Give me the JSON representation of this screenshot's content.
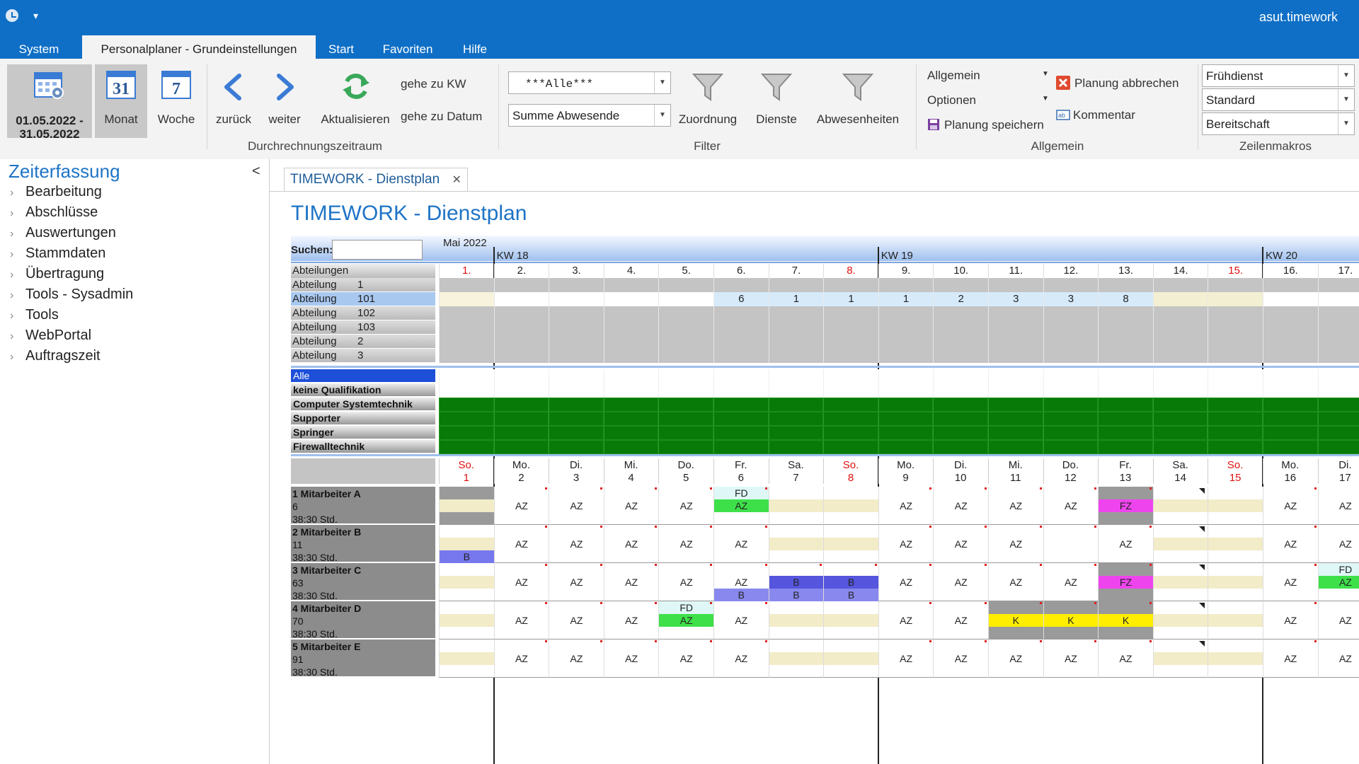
{
  "app": {
    "title": "asut.timework",
    "quick_access": "▾"
  },
  "menu_tabs": [
    "System",
    "Personalplaner - Grundeinstellungen",
    "Start",
    "Favoriten",
    "Hilfe"
  ],
  "ribbon": {
    "date_range_from": "01.05.2022 -",
    "date_range_to": "31.05.2022",
    "monat_label": "Monat",
    "monat_num": "31",
    "woche_label": "Woche",
    "woche_num": "7",
    "zurueck": "zurück",
    "weiter": "weiter",
    "aktualisieren": "Aktualisieren",
    "gehe_kw": "gehe zu KW",
    "gehe_datum": "gehe zu Datum",
    "group_zeitraum": "Durchrechnungszeitraum",
    "filter_combo1": "***Alle***",
    "filter_combo2": "Summe Abwesende",
    "zuordnung": "Zuordnung",
    "dienste": "Dienste",
    "abwesenheiten": "Abwesenheiten",
    "group_filter": "Filter",
    "allgemein": "Allgemein",
    "optionen": "Optionen",
    "planung_speichern": "Planung speichern",
    "planung_abbrechen": "Planung abbrechen",
    "kommentar": "Kommentar",
    "group_allgemein": "Allgemein",
    "makro1": "Frühdienst",
    "makro2": "Standard",
    "makro3": "Bereitschaft",
    "group_makros": "Zeilenmakros"
  },
  "nav": {
    "title": "Zeiterfassung",
    "collapse": "<",
    "items": [
      "Bearbeitung",
      "Abschlüsse",
      "Auswertungen",
      "Stammdaten",
      "Übertragung",
      "Tools - Sysadmin",
      "Tools",
      "WebPortal",
      "Auftragszeit"
    ]
  },
  "doc": {
    "tab": "TIMEWORK - Dienstplan",
    "tab_close": "✕",
    "title": "TIMEWORK - Dienstplan"
  },
  "plan": {
    "search_label": "Suchen:",
    "month_label": "Mai 2022",
    "kw": [
      "KW 18",
      "KW 19",
      "KW 20"
    ],
    "dept_header": "Abteilungen",
    "days": [
      "1.",
      "2.",
      "3.",
      "4.",
      "5.",
      "6.",
      "7.",
      "8.",
      "9.",
      "10.",
      "11.",
      "12.",
      "13.",
      "14.",
      "15.",
      "16.",
      "17."
    ],
    "weekday_short": [
      "So.",
      "Mo.",
      "Di.",
      "Mi.",
      "Do.",
      "Fr.",
      "Sa.",
      "So.",
      "Mo.",
      "Di.",
      "Mi.",
      "Do.",
      "Fr.",
      "Sa.",
      "So.",
      "Mo.",
      "Di."
    ],
    "day_nums": [
      "1",
      "2",
      "3",
      "4",
      "5",
      "6",
      "7",
      "8",
      "9",
      "10",
      "11",
      "12",
      "13",
      "14",
      "15",
      "16",
      "17"
    ],
    "red_days": [
      0,
      7,
      14
    ],
    "departments": [
      {
        "name": "Abteilung",
        "num": "1",
        "values": []
      },
      {
        "name": "Abteilung",
        "num": "101",
        "values": [
          "",
          "",
          "",
          "",
          "",
          "6",
          "1",
          "1",
          "1",
          "2",
          "3",
          "3",
          "8",
          "",
          "",
          "",
          ""
        ]
      },
      {
        "name": "Abteilung",
        "num": "102",
        "values": []
      },
      {
        "name": "Abteilung",
        "num": "103",
        "values": []
      },
      {
        "name": "Abteilung",
        "num": "2",
        "values": []
      },
      {
        "name": "Abteilung",
        "num": "3",
        "values": []
      }
    ],
    "qualifications": [
      "Alle",
      "keine Qualifikation",
      "Computer Systemtechnik",
      "Supporter",
      "Springer",
      "Firewalltechnik"
    ],
    "employees": [
      {
        "label": "1 Mitarbeiter A",
        "num": "6",
        "hours": "38:30 Std.",
        "cells": [
          {
            "type": "absent_top"
          },
          {
            "mid": "AZ"
          },
          {
            "mid": "AZ"
          },
          {
            "mid": "AZ"
          },
          {
            "mid": "AZ"
          },
          {
            "top": "FD",
            "mid": "AZ",
            "mid_color": "#3ee04a",
            "top_color": "#dff7f7"
          },
          {
            "type": "weekend"
          },
          {
            "type": "weekend"
          },
          {
            "mid": "AZ"
          },
          {
            "mid": "AZ"
          },
          {
            "mid": "AZ"
          },
          {
            "mid": "AZ"
          },
          {
            "mid": "FZ",
            "mid_color": "#ee44ee",
            "type": "grey"
          },
          {
            "type": "weekend"
          },
          {
            "type": "weekend"
          },
          {
            "mid": "AZ"
          },
          {
            "mid": "AZ"
          }
        ]
      },
      {
        "label": "2 Mitarbeiter B",
        "num": "11",
        "hours": "38:30 Std.",
        "cells": [
          {
            "type": "weekend",
            "bot": "B",
            "bot_color": "#7777ee"
          },
          {
            "mid": "AZ"
          },
          {
            "mid": "AZ"
          },
          {
            "mid": "AZ"
          },
          {
            "mid": "AZ"
          },
          {
            "mid": "AZ"
          },
          {
            "type": "weekend"
          },
          {
            "type": "weekend"
          },
          {
            "mid": "AZ"
          },
          {
            "mid": "AZ"
          },
          {
            "mid": "AZ"
          },
          {
            "mid": ""
          },
          {
            "mid": "AZ"
          },
          {
            "type": "weekend"
          },
          {
            "type": "weekend"
          },
          {
            "mid": "AZ"
          },
          {
            "mid": "AZ"
          }
        ]
      },
      {
        "label": "3 Mitarbeiter C",
        "num": "63",
        "hours": "38:30 Std.",
        "cells": [
          {
            "type": "weekend"
          },
          {
            "mid": "AZ"
          },
          {
            "mid": "AZ"
          },
          {
            "mid": "AZ"
          },
          {
            "mid": "AZ"
          },
          {
            "mid": "AZ",
            "bot": "B",
            "bot_color": "#8888ee"
          },
          {
            "mid": "B",
            "mid_color": "#5555dd",
            "bot": "B",
            "bot_color": "#8888ee"
          },
          {
            "mid": "B",
            "mid_color": "#5555dd",
            "bot": "B",
            "bot_color": "#8888ee"
          },
          {
            "mid": "AZ"
          },
          {
            "mid": "AZ"
          },
          {
            "mid": "AZ"
          },
          {
            "mid": "AZ"
          },
          {
            "mid": "FZ",
            "mid_color": "#ee44ee",
            "type": "grey"
          },
          {
            "type": "weekend"
          },
          {
            "type": "weekend"
          },
          {
            "mid": "AZ"
          },
          {
            "top": "FD",
            "mid": "AZ",
            "mid_color": "#3ee04a",
            "top_color": "#dff7f7"
          }
        ]
      },
      {
        "label": "4 Mitarbeiter D",
        "num": "70",
        "hours": "38:30 Std.",
        "cells": [
          {
            "type": "weekend"
          },
          {
            "mid": "AZ"
          },
          {
            "mid": "AZ"
          },
          {
            "mid": "AZ"
          },
          {
            "top": "FD",
            "mid": "AZ",
            "mid_color": "#3ee04a",
            "top_color": "#dff7f7"
          },
          {
            "mid": "AZ"
          },
          {
            "type": "weekend"
          },
          {
            "type": "weekend"
          },
          {
            "mid": "AZ"
          },
          {
            "mid": "AZ"
          },
          {
            "mid": "K",
            "mid_color": "#ffee00",
            "type": "grey"
          },
          {
            "mid": "K",
            "mid_color": "#ffee00",
            "type": "grey"
          },
          {
            "mid": "K",
            "mid_color": "#ffee00",
            "type": "grey"
          },
          {
            "type": "weekend"
          },
          {
            "type": "weekend"
          },
          {
            "mid": "AZ"
          },
          {
            "mid": "AZ"
          }
        ]
      },
      {
        "label": "5 Mitarbeiter E",
        "num": "91",
        "hours": "38:30 Std.",
        "cells": [
          {
            "type": "weekend"
          },
          {
            "mid": "AZ"
          },
          {
            "mid": "AZ"
          },
          {
            "mid": "AZ"
          },
          {
            "mid": "AZ"
          },
          {
            "mid": "AZ"
          },
          {
            "type": "weekend"
          },
          {
            "type": "weekend"
          },
          {
            "mid": "AZ"
          },
          {
            "mid": "AZ"
          },
          {
            "mid": "AZ"
          },
          {
            "mid": "AZ"
          },
          {
            "mid": "AZ"
          },
          {
            "type": "weekend"
          },
          {
            "type": "weekend"
          },
          {
            "mid": "AZ"
          },
          {
            "mid": "AZ"
          }
        ]
      }
    ]
  }
}
